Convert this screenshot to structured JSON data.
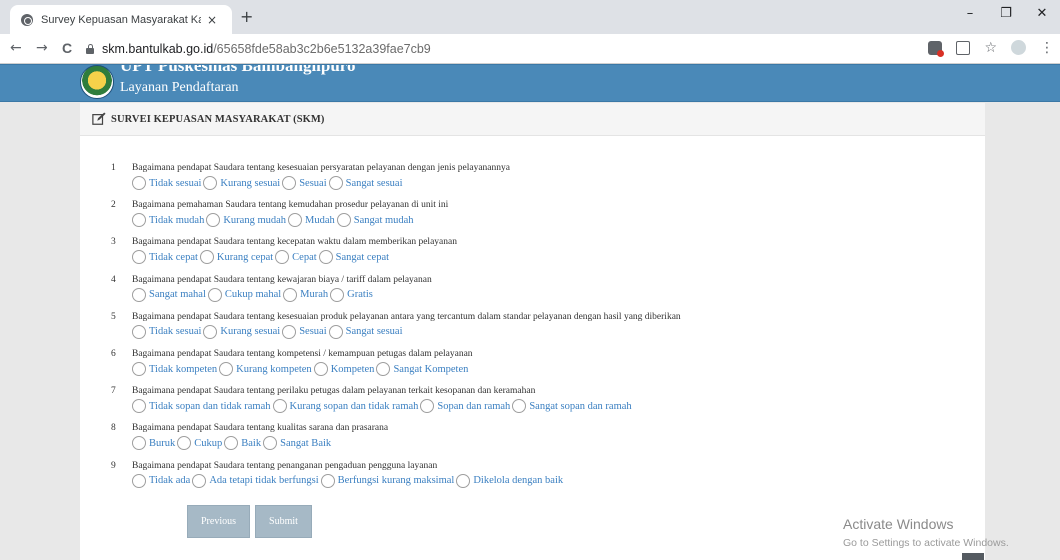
{
  "browser": {
    "tab_title": "Survey Kepuasan Masyarakat Kab",
    "tab_close": "×",
    "new_tab": "+",
    "url_host": "skm.bantulkab.go.id",
    "url_path": "/65658fde58ab3c2b6e5132a39fae7cb9",
    "win_min": "–",
    "win_max": "❐",
    "win_close": "✕",
    "nav_back": "←",
    "nav_forward": "→",
    "nav_reload": "C",
    "icons": [
      "lock-icon",
      "extension-icon",
      "translate-icon",
      "star-icon",
      "profile-icon",
      "menu-icon"
    ]
  },
  "header": {
    "title": "UPT Puskesmas Bambanglipuro",
    "subtitle": "Layanan Pendaftaran",
    "bg_color": "#4a89b8"
  },
  "panel": {
    "title": "SURVEI KEPUASAN MASYARAKAT (SKM)"
  },
  "questions": [
    {
      "num": "1",
      "text": "Bagaimana pendapat Saudara tentang kesesuaian persyaratan pelayanan dengan jenis pelayanannya",
      "options": [
        "Tidak sesuai",
        "Kurang sesuai",
        "Sesuai",
        "Sangat sesuai"
      ]
    },
    {
      "num": "2",
      "text": "Bagaimana pemahaman Saudara tentang kemudahan prosedur pelayanan di unit ini",
      "options": [
        "Tidak mudah",
        "Kurang mudah",
        "Mudah",
        "Sangat mudah"
      ]
    },
    {
      "num": "3",
      "text": "Bagaimana pendapat Saudara tentang kecepatan waktu dalam memberikan pelayanan",
      "options": [
        "Tidak cepat",
        "Kurang cepat",
        "Cepat",
        "Sangat cepat"
      ]
    },
    {
      "num": "4",
      "text": "Bagaimana pendapat Saudara tentang kewajaran biaya / tariff dalam pelayanan",
      "options": [
        "Sangat mahal",
        "Cukup mahal",
        "Murah",
        "Gratis"
      ]
    },
    {
      "num": "5",
      "text": "Bagaimana pendapat Saudara tentang kesesuaian produk pelayanan antara yang tercantum dalam standar pelayanan dengan hasil yang diberikan",
      "options": [
        "Tidak sesuai",
        "Kurang sesuai",
        "Sesuai",
        "Sangat sesuai"
      ]
    },
    {
      "num": "6",
      "text": "Bagaimana pendapat Saudara tentang kompetensi / kemampuan petugas dalam pelayanan",
      "options": [
        "Tidak kompeten",
        "Kurang kompeten",
        "Kompeten",
        "Sangat Kompeten"
      ]
    },
    {
      "num": "7",
      "text": "Bagaimana pendapat Saudara tentang perilaku petugas dalam pelayanan terkait kesopanan dan keramahan",
      "options": [
        "Tidak sopan dan tidak ramah",
        "Kurang sopan dan tidak ramah",
        "Sopan dan ramah",
        "Sangat sopan dan ramah"
      ]
    },
    {
      "num": "8",
      "text": "Bagaimana pendapat Saudara tentang kualitas sarana dan prasarana",
      "options": [
        "Buruk",
        "Cukup",
        "Baik",
        "Sangat Baik"
      ]
    },
    {
      "num": "9",
      "text": "Bagaimana pendapat Saudara tentang penanganan pengaduan pengguna layanan",
      "options": [
        "Tidak ada",
        "Ada tetapi tidak berfungsi",
        "Berfungsi kurang maksimal",
        "Dikelola dengan baik"
      ]
    }
  ],
  "buttons": {
    "previous": "Previous",
    "submit": "Submit",
    "color": "#a6b9c6"
  },
  "watermark": {
    "title": "Activate Windows",
    "subtitle": "Go to Settings to activate Windows."
  }
}
